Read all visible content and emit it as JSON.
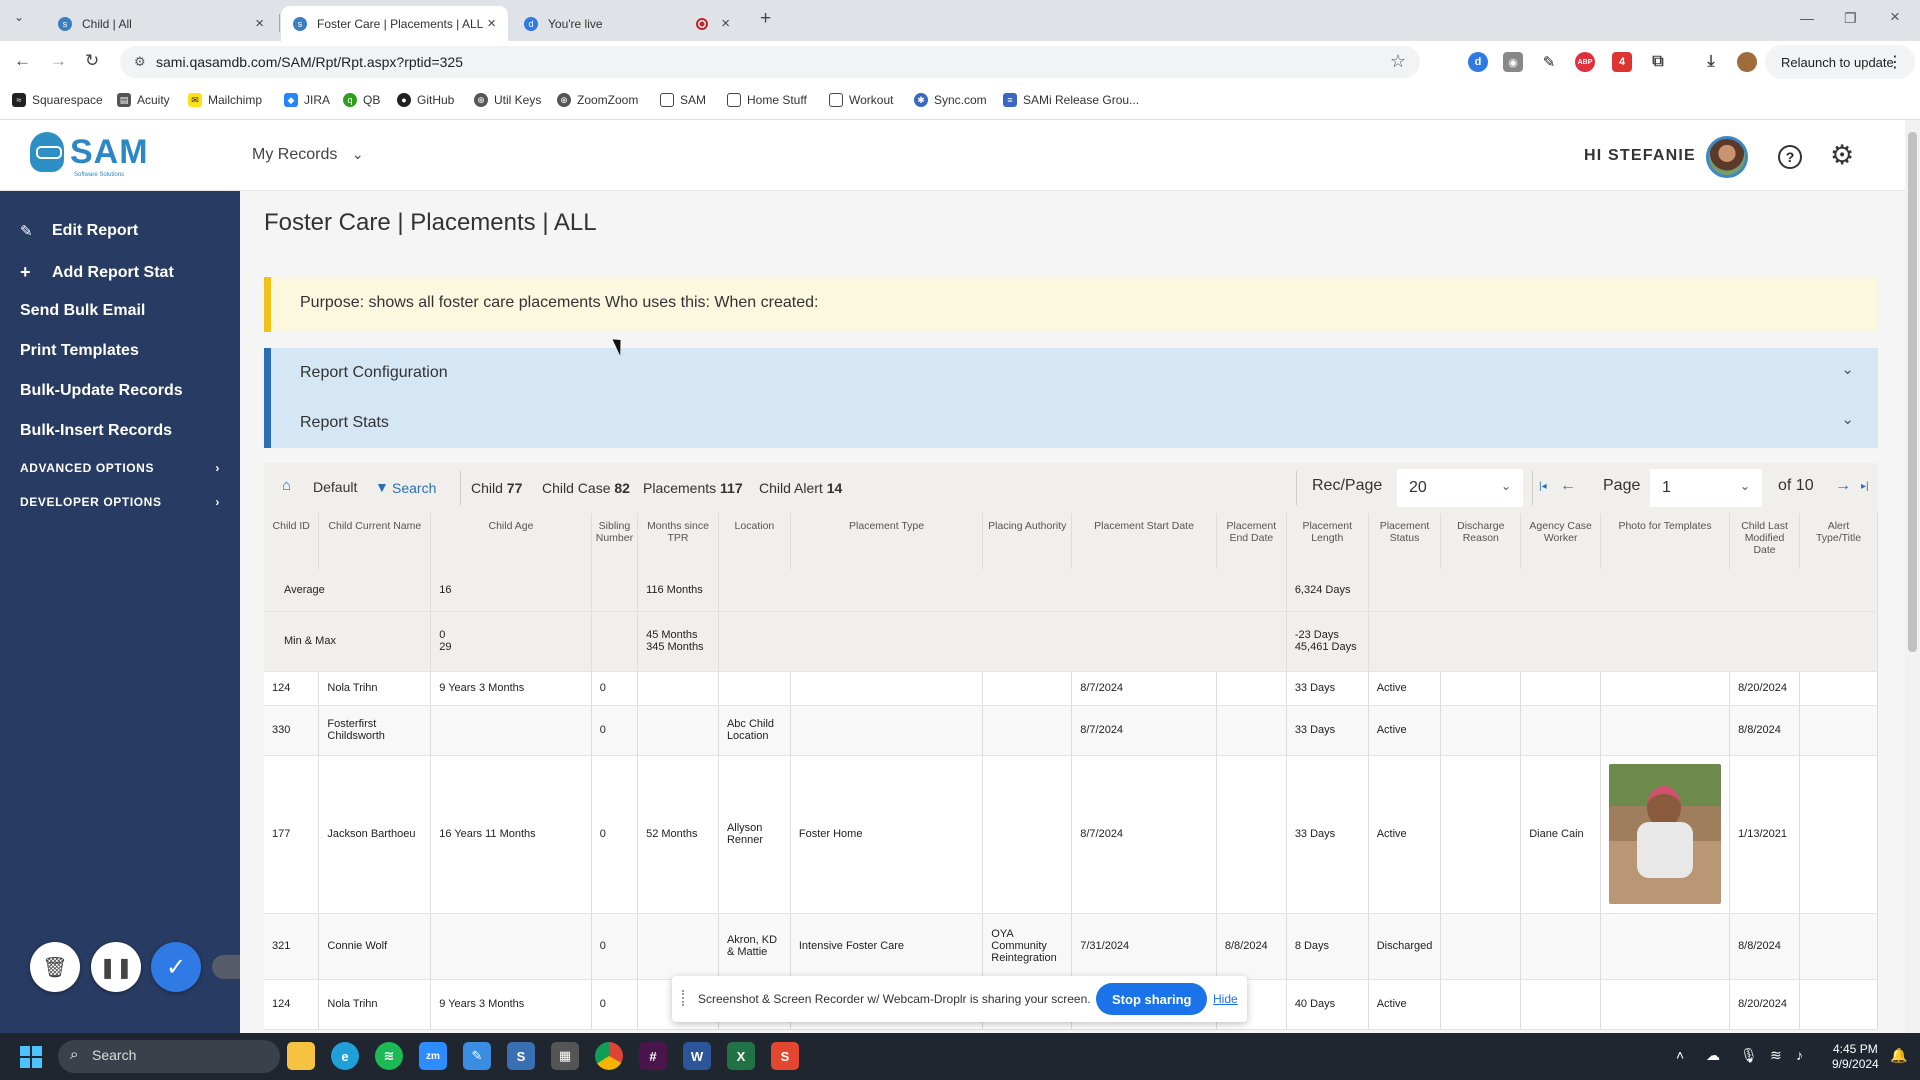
{
  "browser": {
    "tabs": [
      {
        "title": "Child | All",
        "icon": "sam-icon",
        "color": "#3a7fc2"
      },
      {
        "title": "Foster Care | Placements | ALL",
        "icon": "sam-icon",
        "color": "#3a7fc2"
      },
      {
        "title": "You're live",
        "icon": "droplr-icon",
        "color": "#2f7ae5"
      }
    ],
    "url": "sami.qasamdb.com/SAM/Rpt/Rpt.aspx?rptid=325",
    "relaunch_label": "Relaunch to update",
    "bookmarks": [
      "Squarespace",
      "Acuity",
      "Mailchimp",
      "JIRA",
      "QB",
      "GitHub",
      "Util Keys",
      "ZoomZoom",
      "SAM",
      "Home Stuff",
      "Workout",
      "Sync.com",
      "SAMi Release Grou..."
    ]
  },
  "header": {
    "logo_text": "SAM",
    "logo_tag": "Software Solutions",
    "my_records": "My Records",
    "greeting": "HI STEFANIE"
  },
  "sidebar": {
    "items": [
      "Edit Report",
      "Add Report Stat",
      "Send Bulk Email",
      "Print Templates",
      "Bulk-Update Records",
      "Bulk-Insert Records"
    ],
    "advanced": "ADVANCED OPTIONS",
    "developer": "DEVELOPER OPTIONS"
  },
  "page": {
    "title": "Foster Care | Placements | ALL",
    "purpose": "Purpose: shows all foster care placements Who uses this: When created:",
    "report_config": "Report Configuration",
    "report_stats": "Report Stats"
  },
  "toolbar": {
    "default": "Default",
    "search": "Search",
    "child_label": "Child",
    "child_count": "77",
    "child_case_label": "Child Case",
    "child_case_count": "82",
    "placements_label": "Placements",
    "placements_count": "117",
    "child_alert_label": "Child Alert",
    "child_alert_count": "14",
    "rec_page_label": "Rec/Page",
    "rec_page_value": "20",
    "page_label": "Page",
    "page_value": "1",
    "of_pages": "of 10"
  },
  "table": {
    "columns": [
      "Child ID",
      "Child Current Name",
      "Child Age",
      "Sibling Number",
      "Months since TPR",
      "Location",
      "Placement Type",
      "Placing Authority",
      "Placement Start Date",
      "Placement End Date",
      "Placement Length",
      "Placement Status",
      "Discharge Reason",
      "Agency Case Worker",
      "Photo for Templates",
      "Child Last Modified Date",
      "Alert Type/Title"
    ],
    "stats": [
      {
        "label": "Average",
        "age": "16",
        "tpr": "116 Months",
        "length": "6,324 Days"
      },
      {
        "label": "Min & Max",
        "age_min": "0",
        "age_max": "29",
        "tpr_min": "45 Months",
        "tpr_max": "345 Months",
        "length_min": "-23 Days",
        "length_max": "45,461 Days"
      }
    ],
    "rows": [
      {
        "id": "124",
        "name": "Nola Trihn",
        "age": "9 Years 3 Months",
        "sibling": "0",
        "tpr": "",
        "location": "",
        "type": "",
        "authority": "",
        "start": "8/7/2024",
        "end": "",
        "length": "33 Days",
        "status": "Active",
        "discharge": "",
        "worker": "",
        "photo": false,
        "modified": "8/20/2024",
        "alert": ""
      },
      {
        "id": "330",
        "name": "Fosterfirst Childsworth",
        "age": "",
        "sibling": "0",
        "tpr": "",
        "location": "Abc Child Location",
        "type": "",
        "authority": "",
        "start": "8/7/2024",
        "end": "",
        "length": "33 Days",
        "status": "Active",
        "discharge": "",
        "worker": "",
        "photo": false,
        "modified": "8/8/2024",
        "alert": ""
      },
      {
        "id": "177",
        "name": "Jackson Barthoeu",
        "age": "16 Years 11 Months",
        "sibling": "0",
        "tpr": "52 Months",
        "location": "Allyson Renner",
        "type": "Foster Home",
        "authority": "",
        "start": "8/7/2024",
        "end": "",
        "length": "33 Days",
        "status": "Active",
        "discharge": "",
        "worker": "Diane Cain",
        "photo": true,
        "modified": "1/13/2021",
        "alert": ""
      },
      {
        "id": "321",
        "name": "Connie Wolf",
        "age": "",
        "sibling": "0",
        "tpr": "",
        "location": "Akron, KD & Mattie",
        "type": "Intensive Foster Care",
        "authority": "OYA Community Reintegration",
        "start": "7/31/2024",
        "end": "8/8/2024",
        "length": "8 Days",
        "status": "Discharged",
        "discharge": "",
        "worker": "",
        "photo": false,
        "modified": "8/8/2024",
        "alert": ""
      },
      {
        "id": "124",
        "name": "Nola Trihn",
        "age": "9 Years 3 Months",
        "sibling": "0",
        "tpr": "",
        "location": "",
        "type": "",
        "authority": "",
        "start": "",
        "end": "",
        "length": "40 Days",
        "status": "Active",
        "discharge": "",
        "worker": "",
        "photo": false,
        "modified": "8/20/2024",
        "alert": ""
      }
    ]
  },
  "share_bar": {
    "message": "Screenshot & Screen Recorder w/ Webcam-Droplr is sharing your screen.",
    "stop": "Stop sharing",
    "hide": "Hide"
  },
  "taskbar": {
    "search": "Search",
    "time": "4:45 PM",
    "date": "9/9/2024"
  },
  "colors": {
    "sidebar": "#283c63",
    "purpose_bg": "#fcf7df",
    "purpose_accent": "#f3c01a",
    "accordion_bg": "#d5e6f4",
    "accordion_accent": "#2c6fb4",
    "brand": "#2c87c5"
  }
}
